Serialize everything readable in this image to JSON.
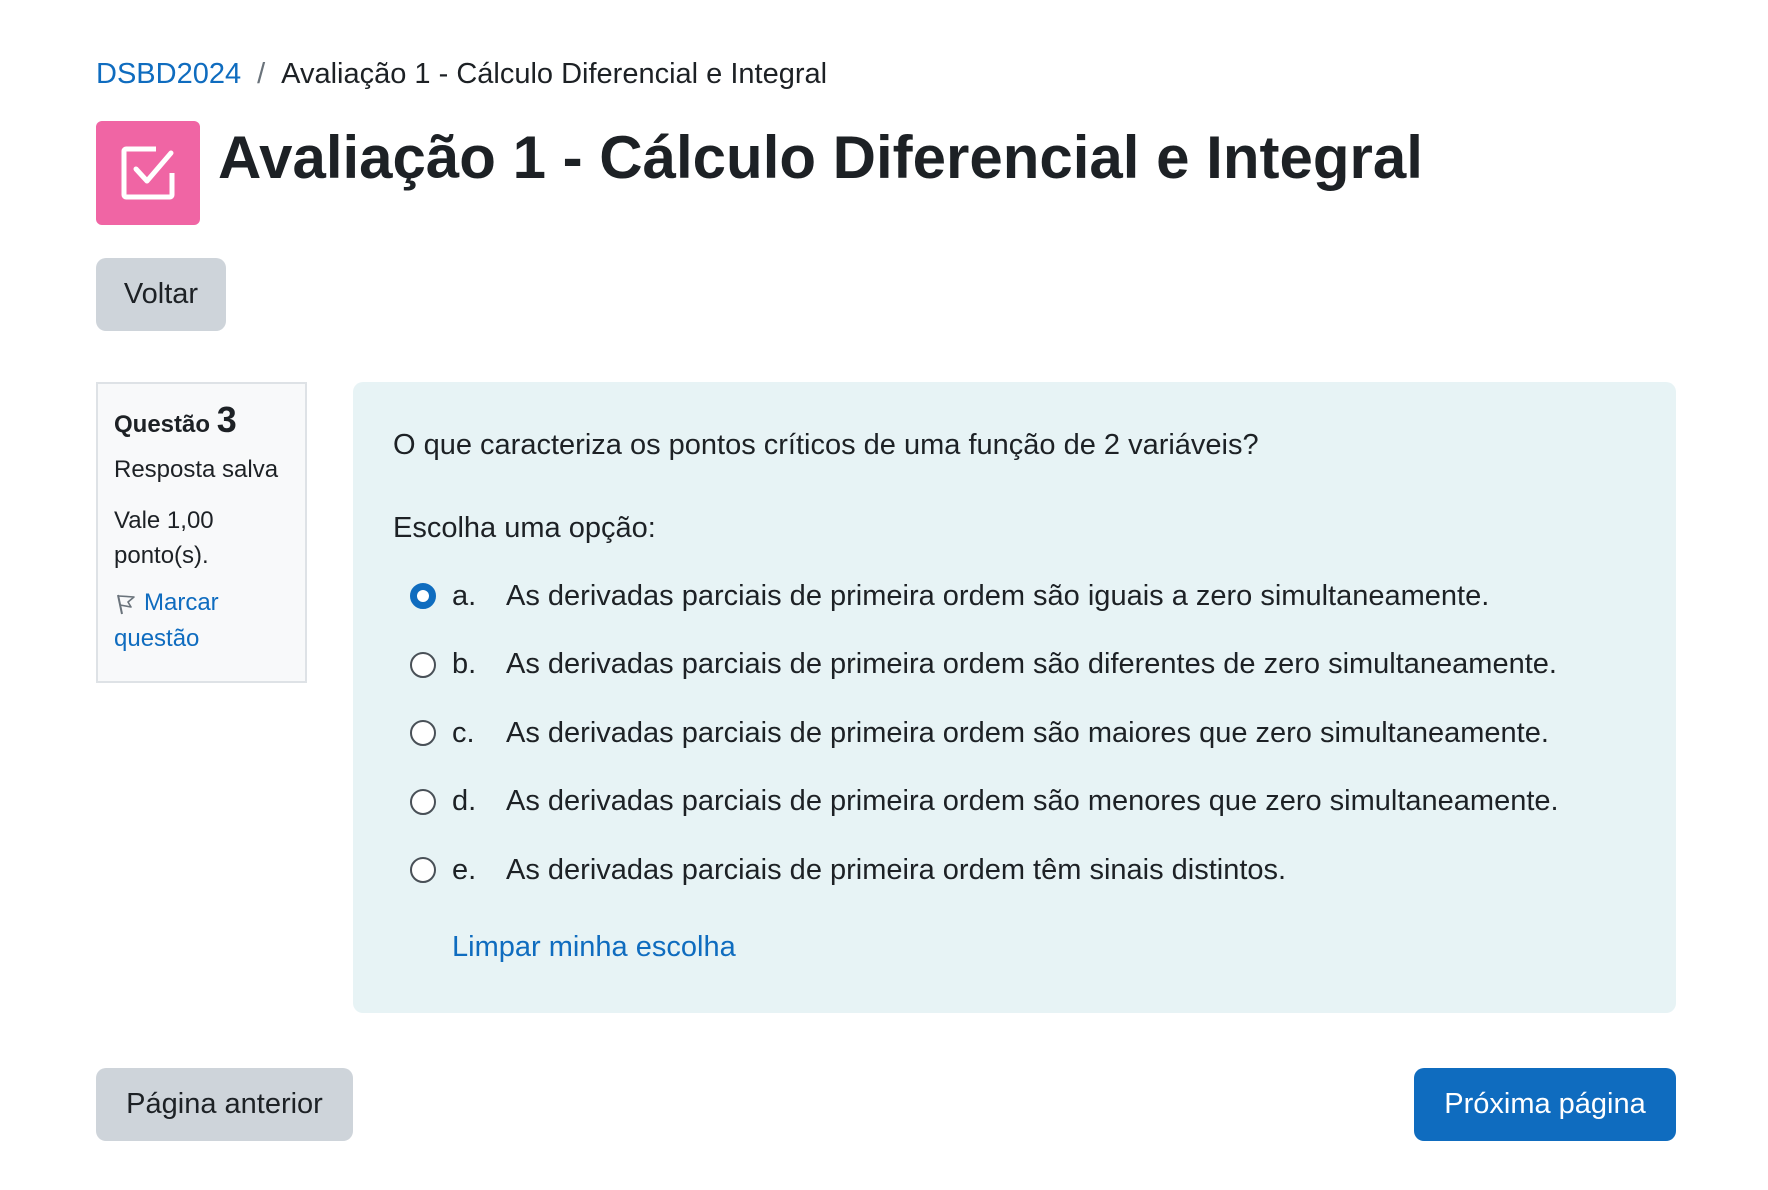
{
  "breadcrumb": {
    "course": "DSBD2024",
    "separator": "/",
    "current": "Avaliação 1 - Cálculo Diferencial e Integral"
  },
  "header": {
    "title": "Avaliação 1 - Cálculo Diferencial e Integral",
    "icon": "quiz-checkbox-icon",
    "icon_color": "#f065a4"
  },
  "back_button": "Voltar",
  "question_info": {
    "label": "Questão",
    "number": "3",
    "state": "Resposta salva",
    "grade": "Vale 1,00 ponto(s).",
    "flag": "Marcar questão"
  },
  "question": {
    "text": "O que caracteriza os pontos críticos de uma função de 2 variáveis?",
    "prompt": "Escolha uma opção:",
    "answers": [
      {
        "letter": "a.",
        "text": "As derivadas parciais de primeira ordem são iguais a zero simultaneamente.",
        "selected": true
      },
      {
        "letter": "b.",
        "text": "As derivadas parciais de primeira ordem são diferentes de zero simultaneamente.",
        "selected": false
      },
      {
        "letter": "c.",
        "text": "As derivadas parciais de primeira ordem são maiores que zero simultaneamente.",
        "selected": false
      },
      {
        "letter": "d.",
        "text": "As derivadas parciais de primeira ordem são menores que zero simultaneamente.",
        "selected": false
      },
      {
        "letter": "e.",
        "text": "As derivadas parciais de primeira ordem têm sinais distintos.",
        "selected": false
      }
    ],
    "clear_choice": "Limpar minha escolha"
  },
  "navigation": {
    "previous": "Página anterior",
    "next": "Próxima página"
  },
  "colors": {
    "accent": "#0f6cbf",
    "content_bg": "#e7f3f5",
    "secondary_button": "#ced4da"
  }
}
